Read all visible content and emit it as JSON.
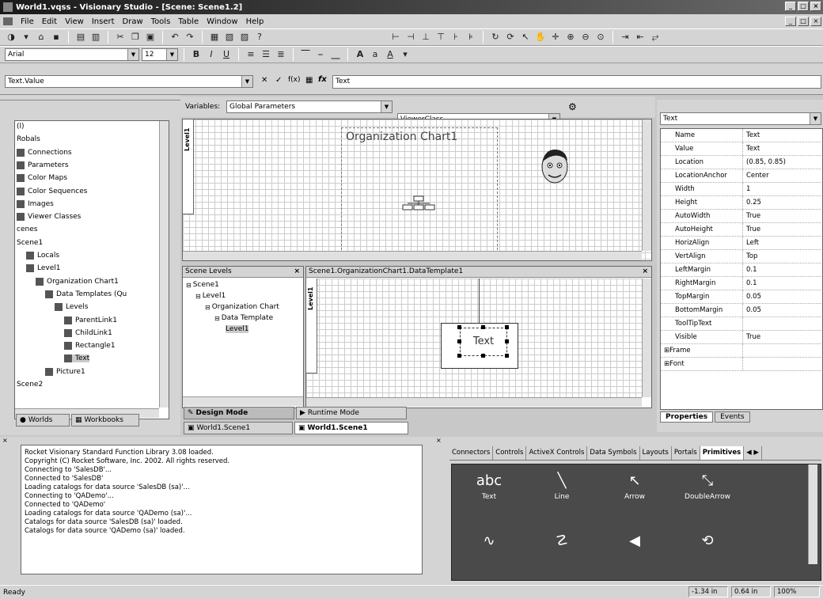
{
  "window": {
    "title": "World1.vqss - Visionary Studio - [Scene: Scene1.2]",
    "menu": [
      "File",
      "Edit",
      "View",
      "Insert",
      "Draw",
      "Tools",
      "Table",
      "Window",
      "Help"
    ]
  },
  "format_bar": {
    "font": "Arial",
    "size": "12",
    "bold": "B",
    "italic": "I",
    "underline": "U"
  },
  "formula_bar": {
    "field": "Text.Value",
    "cancel": "✕",
    "accept": "✓",
    "fx": "fx",
    "value": "Text"
  },
  "variables_bar": {
    "label": "Variables:",
    "selected": "Global Parameters",
    "viewer": "ViewerClass"
  },
  "tree": {
    "items": [
      {
        "label": "(l)",
        "indent": 0
      },
      {
        "label": "Robals",
        "indent": 0
      },
      {
        "label": "Connections",
        "indent": 0
      },
      {
        "label": "Parameters",
        "indent": 0
      },
      {
        "label": "Color Maps",
        "indent": 0
      },
      {
        "label": "Color Sequences",
        "indent": 0
      },
      {
        "label": "Images",
        "indent": 0
      },
      {
        "label": "Viewer Classes",
        "indent": 0
      },
      {
        "label": "cenes",
        "indent": 0
      },
      {
        "label": "Scene1",
        "indent": 0
      },
      {
        "label": "Locals",
        "indent": 1
      },
      {
        "label": "Level1",
        "indent": 1
      },
      {
        "label": "Organization Chart1",
        "indent": 2
      },
      {
        "label": "Data Templates (Qu",
        "indent": 3
      },
      {
        "label": "Levels",
        "indent": 4
      },
      {
        "label": "ParentLink1",
        "indent": 5
      },
      {
        "label": "ChildLink1",
        "indent": 5
      },
      {
        "label": "Rectangle1",
        "indent": 5
      },
      {
        "label": "Text",
        "indent": 5
      },
      {
        "label": "Picture1",
        "indent": 3
      },
      {
        "label": "Scene2",
        "indent": 0
      }
    ],
    "tabs": [
      "Worlds",
      "Workbooks"
    ]
  },
  "canvas_top": {
    "level_label": "Level1",
    "chart_title": "Organization Chart1"
  },
  "scene_levels": {
    "header": "Scene Levels",
    "items": [
      {
        "label": "Scene1",
        "indent": 0
      },
      {
        "label": "Level1",
        "indent": 1
      },
      {
        "label": "Organization Chart",
        "indent": 2
      },
      {
        "label": "Data Template",
        "indent": 3
      },
      {
        "label": "Level1",
        "indent": 4
      }
    ]
  },
  "template_pane": {
    "header": "Scene1.OrganizationChart1.DataTemplate1",
    "level_label": "Level1",
    "text_box": "Text"
  },
  "mode_tabs": {
    "design": "Design Mode",
    "runtime": "Runtime Mode"
  },
  "doc_tabs": [
    "World1.Scene1",
    "World1.Scene1"
  ],
  "properties": {
    "object": "Text",
    "rows": [
      {
        "k": "Name",
        "v": "Text"
      },
      {
        "k": "Value",
        "v": "Text"
      },
      {
        "k": "Location",
        "v": "(0.85, 0.85)"
      },
      {
        "k": "LocationAnchor",
        "v": "Center"
      },
      {
        "k": "Width",
        "v": "1"
      },
      {
        "k": "Height",
        "v": "0.25"
      },
      {
        "k": "AutoWidth",
        "v": "True"
      },
      {
        "k": "AutoHeight",
        "v": "True"
      },
      {
        "k": "HorizAlign",
        "v": "Left"
      },
      {
        "k": "VertAlign",
        "v": "Top"
      },
      {
        "k": "LeftMargin",
        "v": "0.1"
      },
      {
        "k": "RightMargin",
        "v": "0.1"
      },
      {
        "k": "TopMargin",
        "v": "0.05"
      },
      {
        "k": "BottomMargin",
        "v": "0.05"
      },
      {
        "k": "ToolTipText",
        "v": ""
      },
      {
        "k": "Visible",
        "v": "True"
      },
      {
        "k": "Frame",
        "v": ""
      },
      {
        "k": "Font",
        "v": ""
      }
    ],
    "tabs": [
      "Properties",
      "Events"
    ]
  },
  "log": {
    "lines": [
      "Rocket Visionary Standard Function Library 3.08 loaded.",
      "Copyright (C) Rocket Software, Inc. 2002.  All rights reserved.",
      "Connecting to 'SalesDB'...",
      "Connected to 'SalesDB'",
      "Loading catalogs for data source 'SalesDB (sa)'...",
      "Connecting to 'QADemo'...",
      "Connected to 'QADemo'",
      "Loading catalogs for data source 'QADemo (sa)'...",
      "Catalogs for data source 'SalesDB (sa)' loaded.",
      "Catalogs for data source 'QADemo (sa)' loaded."
    ]
  },
  "palette": {
    "tabs": [
      "Connectors",
      "Controls",
      "ActiveX Controls",
      "Data Symbols",
      "Layouts",
      "Portals",
      "Primitives"
    ],
    "items": [
      {
        "label": "Text",
        "glyph": "abc"
      },
      {
        "label": "Line",
        "glyph": "╲"
      },
      {
        "label": "Arrow",
        "glyph": "↖"
      },
      {
        "label": "DoubleArrow",
        "glyph": "⤡"
      },
      {
        "label": "",
        "glyph": "∿"
      },
      {
        "label": "",
        "glyph": "☡"
      },
      {
        "label": "",
        "glyph": "◀"
      },
      {
        "label": "",
        "glyph": "⟲"
      }
    ]
  },
  "status": {
    "text": "Ready",
    "x": "-1.34 in",
    "y": "0.64 in",
    "zoom": "100%"
  }
}
